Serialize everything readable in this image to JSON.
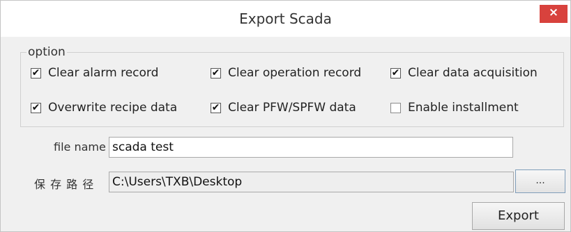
{
  "window": {
    "title": "Export Scada",
    "close_glyph": "×"
  },
  "option_group": {
    "legend": "option",
    "checkboxes": [
      {
        "label": "Clear alarm record",
        "checked": true
      },
      {
        "label": "Clear operation record",
        "checked": true
      },
      {
        "label": "Clear data acquisition",
        "checked": true
      },
      {
        "label": "Overwrite recipe data",
        "checked": true
      },
      {
        "label": "Clear PFW/SPFW data",
        "checked": true
      },
      {
        "label": "Enable installment",
        "checked": false
      }
    ]
  },
  "file_name": {
    "label": "file name",
    "value": "scada test"
  },
  "save_path": {
    "label": "保 存 路 径",
    "value": "C:\\Users\\TXB\\Desktop",
    "browse_label": "..."
  },
  "actions": {
    "export_label": "Export"
  },
  "check_glyph": "✔",
  "colors": {
    "close_button": "#d8423d",
    "window_bg": "#f0f0f0"
  }
}
